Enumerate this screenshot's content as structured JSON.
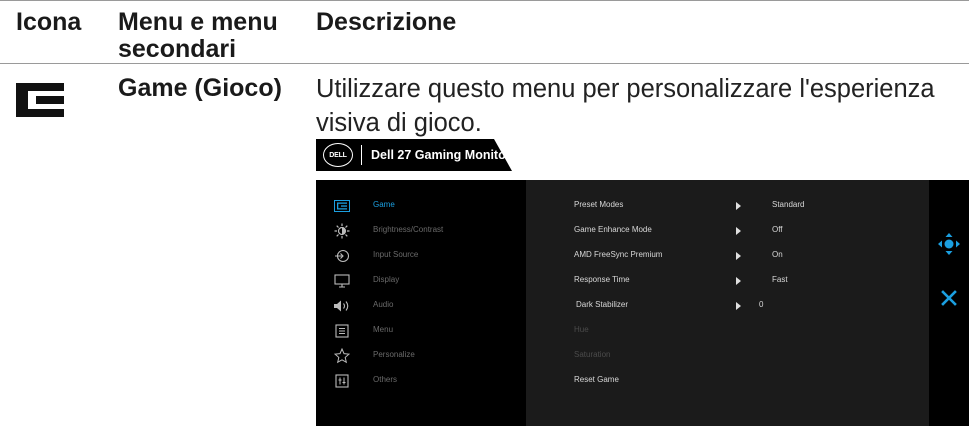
{
  "header": {
    "col_icon": "Icona",
    "col_menu": "Menu e menu secondari",
    "col_desc": "Descrizione"
  },
  "entry": {
    "icon_name": "game-icon",
    "title": "Game (Gioco)",
    "description": "Utilizzare questo menu per personalizzare l'esperienza visiva di gioco."
  },
  "monitor": {
    "brand": "DELL",
    "title": "Dell 27 Gaming Monitor"
  },
  "osd": {
    "nav": [
      {
        "label": "Game",
        "icon": "game-icon",
        "active": true
      },
      {
        "label": "Brightness/Contrast",
        "icon": "brightness-icon",
        "active": false
      },
      {
        "label": "Input Source",
        "icon": "input-source-icon",
        "active": false
      },
      {
        "label": "Display",
        "icon": "display-icon",
        "active": false
      },
      {
        "label": "Audio",
        "icon": "speaker-icon",
        "active": false
      },
      {
        "label": "Menu",
        "icon": "menu-icon",
        "active": false
      },
      {
        "label": "Personalize",
        "icon": "star-icon",
        "active": false
      },
      {
        "label": "Others",
        "icon": "others-icon",
        "active": false
      }
    ],
    "rows": [
      {
        "label": "Preset Modes",
        "value": "Standard"
      },
      {
        "label": "Game Enhance Mode",
        "value": "Off"
      },
      {
        "label": "AMD FreeSync Premium",
        "value": "On"
      },
      {
        "label": "Response Time",
        "value": "Fast"
      },
      {
        "label": "Dark Stabilizer",
        "value": "0"
      },
      {
        "label": "Hue",
        "value": ""
      },
      {
        "label": "Saturation",
        "value": ""
      },
      {
        "label": "Reset Game",
        "value": ""
      }
    ],
    "side_icons": [
      "joystick-icon",
      "close-icon"
    ]
  },
  "colors": {
    "accent": "#1b9fe0",
    "osd_bg": "#000000",
    "osd_panel": "#1b1b1b"
  }
}
